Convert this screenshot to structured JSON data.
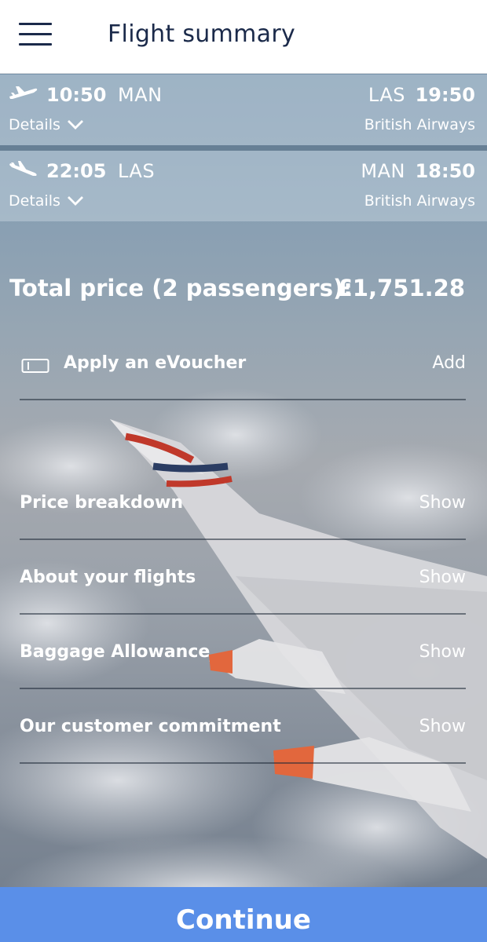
{
  "header": {
    "title": "Flight summary"
  },
  "flights": [
    {
      "dep_time": "10:50",
      "dep_code": "MAN",
      "arr_code": "LAS",
      "arr_time": "19:50",
      "details_label": "Details",
      "airline": "British Airways"
    },
    {
      "dep_time": "22:05",
      "dep_code": "LAS",
      "arr_code": "MAN",
      "arr_time": "18:50",
      "details_label": "Details",
      "airline": "British Airways"
    }
  ],
  "total": {
    "label": "Total price (2 passengers):",
    "value": "£1,751.28"
  },
  "voucher": {
    "label": "Apply an eVoucher",
    "action": "Add",
    "icon": "voucher-icon"
  },
  "sections": [
    {
      "label": "Price breakdown",
      "action": "Show"
    },
    {
      "label": "About your flights",
      "action": "Show"
    },
    {
      "label": "Baggage Allowance",
      "action": "Show"
    },
    {
      "label": "Our customer commitment",
      "action": "Show"
    }
  ],
  "continue_label": "Continue",
  "colors": {
    "header_text": "#1b2a4a",
    "button": "#5a8fe8"
  }
}
